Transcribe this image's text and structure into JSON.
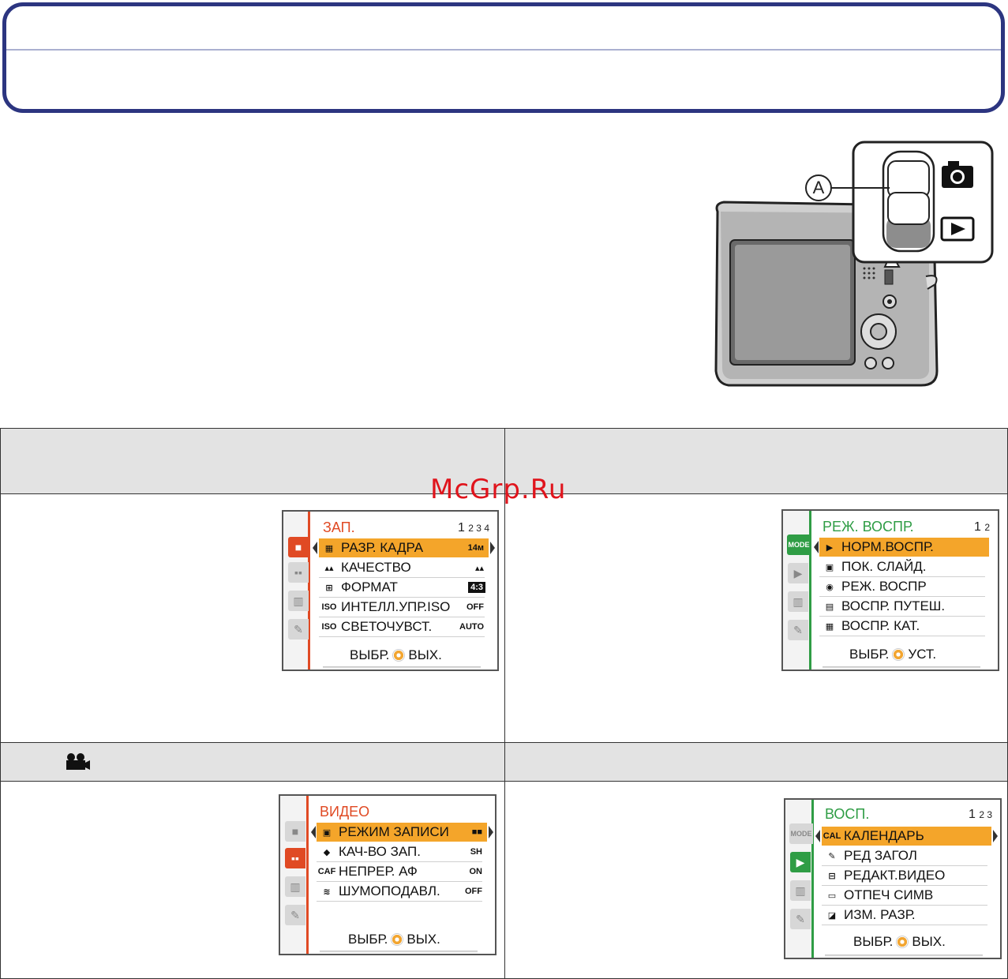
{
  "watermark": "McGrp.Ru",
  "camera": {
    "callout": "A"
  },
  "section_video": {
    "icon": "movie-camera-icon"
  },
  "menus": {
    "rec": {
      "title": "ЗАП.",
      "page": "1",
      "pages_rest": "2 3 4",
      "items": [
        {
          "icon": "▦",
          "label": "РАЗР. КАДРА",
          "value": "14м"
        },
        {
          "icon": "▴▴",
          "label": "КАЧЕСТВО",
          "value": "▴▴"
        },
        {
          "icon": "⊞",
          "label": "ФОРМАТ",
          "value": "4:3"
        },
        {
          "icon": "ISO",
          "label": "ИНТЕЛЛ.УПР.ISO",
          "value": "OFF"
        },
        {
          "icon": "ISO",
          "label": "СВЕТОЧУВСТ.",
          "value": "AUTO"
        }
      ],
      "footer_select": "ВЫБР.",
      "footer_action": "ВЫХ."
    },
    "play_mode": {
      "title": "РЕЖ. ВОСПР.",
      "page": "1",
      "pages_rest": "2",
      "mode_tab": "MODE",
      "items": [
        {
          "icon": "▶",
          "label": "НОРМ.ВОСПР."
        },
        {
          "icon": "▣",
          "label": "ПОК. СЛАЙД."
        },
        {
          "icon": "◉",
          "label": "РЕЖ. ВОСПР"
        },
        {
          "icon": "▤",
          "label": "ВОСПР. ПУТЕШ."
        },
        {
          "icon": "▦",
          "label": "ВОСПР. КАТ."
        }
      ],
      "footer_select": "ВЫБР.",
      "footer_action": "УСТ."
    },
    "video": {
      "title": "ВИДЕО",
      "items": [
        {
          "icon": "▣",
          "label": "РЕЖИМ ЗАПИСИ",
          "value": "■■"
        },
        {
          "icon": "◆",
          "label": "КАЧ-ВО ЗАП.",
          "value": "SH"
        },
        {
          "icon": "CAF",
          "label": "НЕПРЕР. АФ",
          "value": "ON"
        },
        {
          "icon": "≋",
          "label": "ШУМОПОДАВЛ.",
          "value": "OFF"
        }
      ],
      "footer_select": "ВЫБР.",
      "footer_action": "ВЫХ."
    },
    "playback": {
      "title": "ВОСП.",
      "page": "1",
      "pages_rest": "2 3",
      "mode_tab": "MODE",
      "items": [
        {
          "icon": "CAL",
          "label": "КАЛЕНДАРЬ"
        },
        {
          "icon": "✎",
          "label": "РЕД ЗАГОЛ"
        },
        {
          "icon": "⊟",
          "label": "РЕДАКТ.ВИДЕО"
        },
        {
          "icon": "▭",
          "label": "ОТПЕЧ СИМВ"
        },
        {
          "icon": "◪",
          "label": "ИЗМ. РАЗР."
        }
      ],
      "footer_select": "ВЫБР.",
      "footer_action": "ВЫХ."
    }
  }
}
